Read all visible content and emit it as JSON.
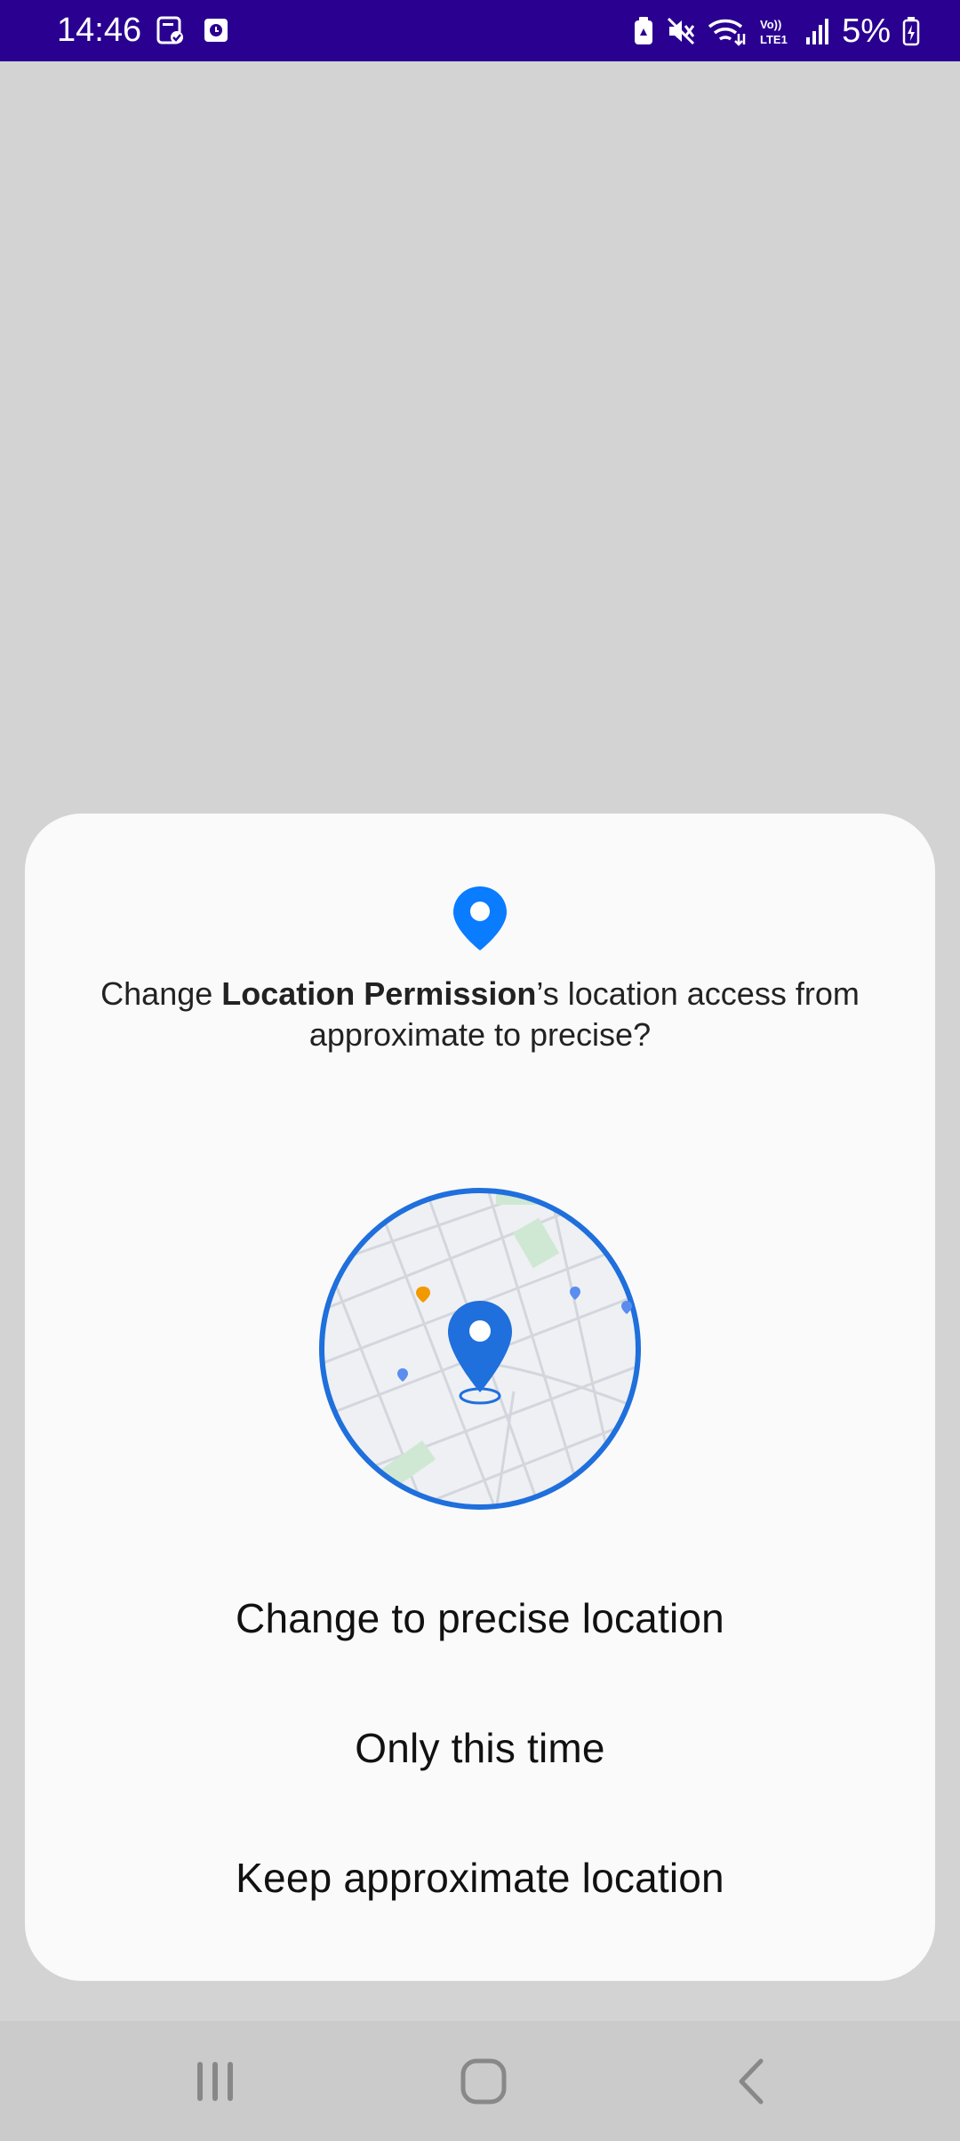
{
  "status_bar": {
    "time": "14:46",
    "battery": "5%",
    "left_icons": [
      "notes-icon",
      "clock-app-icon"
    ],
    "right_icons": [
      "battery-saver-icon",
      "mute-icon",
      "wifi-icon",
      "volte-lte-icon",
      "signal-icon",
      "battery-charging-icon"
    ],
    "volte_label": "Vo)) LTE1"
  },
  "dialog": {
    "message_prefix": "Change ",
    "app_name": "Location Permission",
    "message_suffix": "’s location access from approximate to precise?",
    "buttons": {
      "precise": "Change to precise location",
      "once": "Only this time",
      "keep": "Keep approximate location"
    }
  },
  "colors": {
    "status_bar": "#2a0091",
    "accent": "#1a73e8",
    "dialog_bg": "#fafafa",
    "scrim": "#d3d3d3"
  },
  "nav_bar": {
    "buttons": [
      "recents-icon",
      "home-icon",
      "back-icon"
    ]
  }
}
